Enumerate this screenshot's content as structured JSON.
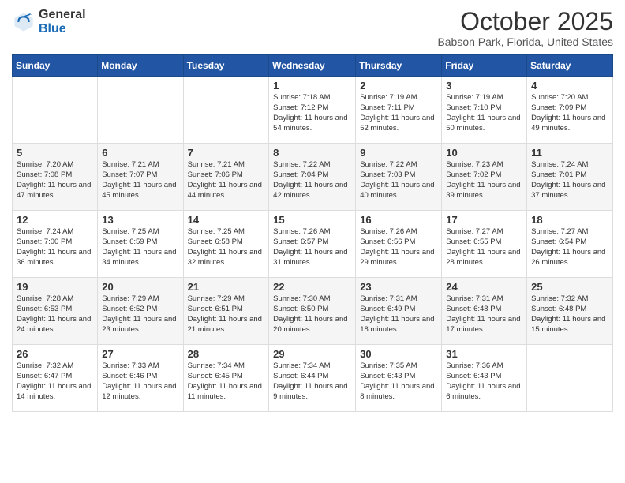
{
  "header": {
    "logo_general": "General",
    "logo_blue": "Blue",
    "month_title": "October 2025",
    "location": "Babson Park, Florida, United States"
  },
  "weekdays": [
    "Sunday",
    "Monday",
    "Tuesday",
    "Wednesday",
    "Thursday",
    "Friday",
    "Saturday"
  ],
  "weeks": [
    [
      {
        "day": "",
        "info": ""
      },
      {
        "day": "",
        "info": ""
      },
      {
        "day": "",
        "info": ""
      },
      {
        "day": "1",
        "info": "Sunrise: 7:18 AM\nSunset: 7:12 PM\nDaylight: 11 hours and 54 minutes."
      },
      {
        "day": "2",
        "info": "Sunrise: 7:19 AM\nSunset: 7:11 PM\nDaylight: 11 hours and 52 minutes."
      },
      {
        "day": "3",
        "info": "Sunrise: 7:19 AM\nSunset: 7:10 PM\nDaylight: 11 hours and 50 minutes."
      },
      {
        "day": "4",
        "info": "Sunrise: 7:20 AM\nSunset: 7:09 PM\nDaylight: 11 hours and 49 minutes."
      }
    ],
    [
      {
        "day": "5",
        "info": "Sunrise: 7:20 AM\nSunset: 7:08 PM\nDaylight: 11 hours and 47 minutes."
      },
      {
        "day": "6",
        "info": "Sunrise: 7:21 AM\nSunset: 7:07 PM\nDaylight: 11 hours and 45 minutes."
      },
      {
        "day": "7",
        "info": "Sunrise: 7:21 AM\nSunset: 7:06 PM\nDaylight: 11 hours and 44 minutes."
      },
      {
        "day": "8",
        "info": "Sunrise: 7:22 AM\nSunset: 7:04 PM\nDaylight: 11 hours and 42 minutes."
      },
      {
        "day": "9",
        "info": "Sunrise: 7:22 AM\nSunset: 7:03 PM\nDaylight: 11 hours and 40 minutes."
      },
      {
        "day": "10",
        "info": "Sunrise: 7:23 AM\nSunset: 7:02 PM\nDaylight: 11 hours and 39 minutes."
      },
      {
        "day": "11",
        "info": "Sunrise: 7:24 AM\nSunset: 7:01 PM\nDaylight: 11 hours and 37 minutes."
      }
    ],
    [
      {
        "day": "12",
        "info": "Sunrise: 7:24 AM\nSunset: 7:00 PM\nDaylight: 11 hours and 36 minutes."
      },
      {
        "day": "13",
        "info": "Sunrise: 7:25 AM\nSunset: 6:59 PM\nDaylight: 11 hours and 34 minutes."
      },
      {
        "day": "14",
        "info": "Sunrise: 7:25 AM\nSunset: 6:58 PM\nDaylight: 11 hours and 32 minutes."
      },
      {
        "day": "15",
        "info": "Sunrise: 7:26 AM\nSunset: 6:57 PM\nDaylight: 11 hours and 31 minutes."
      },
      {
        "day": "16",
        "info": "Sunrise: 7:26 AM\nSunset: 6:56 PM\nDaylight: 11 hours and 29 minutes."
      },
      {
        "day": "17",
        "info": "Sunrise: 7:27 AM\nSunset: 6:55 PM\nDaylight: 11 hours and 28 minutes."
      },
      {
        "day": "18",
        "info": "Sunrise: 7:27 AM\nSunset: 6:54 PM\nDaylight: 11 hours and 26 minutes."
      }
    ],
    [
      {
        "day": "19",
        "info": "Sunrise: 7:28 AM\nSunset: 6:53 PM\nDaylight: 11 hours and 24 minutes."
      },
      {
        "day": "20",
        "info": "Sunrise: 7:29 AM\nSunset: 6:52 PM\nDaylight: 11 hours and 23 minutes."
      },
      {
        "day": "21",
        "info": "Sunrise: 7:29 AM\nSunset: 6:51 PM\nDaylight: 11 hours and 21 minutes."
      },
      {
        "day": "22",
        "info": "Sunrise: 7:30 AM\nSunset: 6:50 PM\nDaylight: 11 hours and 20 minutes."
      },
      {
        "day": "23",
        "info": "Sunrise: 7:31 AM\nSunset: 6:49 PM\nDaylight: 11 hours and 18 minutes."
      },
      {
        "day": "24",
        "info": "Sunrise: 7:31 AM\nSunset: 6:48 PM\nDaylight: 11 hours and 17 minutes."
      },
      {
        "day": "25",
        "info": "Sunrise: 7:32 AM\nSunset: 6:48 PM\nDaylight: 11 hours and 15 minutes."
      }
    ],
    [
      {
        "day": "26",
        "info": "Sunrise: 7:32 AM\nSunset: 6:47 PM\nDaylight: 11 hours and 14 minutes."
      },
      {
        "day": "27",
        "info": "Sunrise: 7:33 AM\nSunset: 6:46 PM\nDaylight: 11 hours and 12 minutes."
      },
      {
        "day": "28",
        "info": "Sunrise: 7:34 AM\nSunset: 6:45 PM\nDaylight: 11 hours and 11 minutes."
      },
      {
        "day": "29",
        "info": "Sunrise: 7:34 AM\nSunset: 6:44 PM\nDaylight: 11 hours and 9 minutes."
      },
      {
        "day": "30",
        "info": "Sunrise: 7:35 AM\nSunset: 6:43 PM\nDaylight: 11 hours and 8 minutes."
      },
      {
        "day": "31",
        "info": "Sunrise: 7:36 AM\nSunset: 6:43 PM\nDaylight: 11 hours and 6 minutes."
      },
      {
        "day": "",
        "info": ""
      }
    ]
  ]
}
